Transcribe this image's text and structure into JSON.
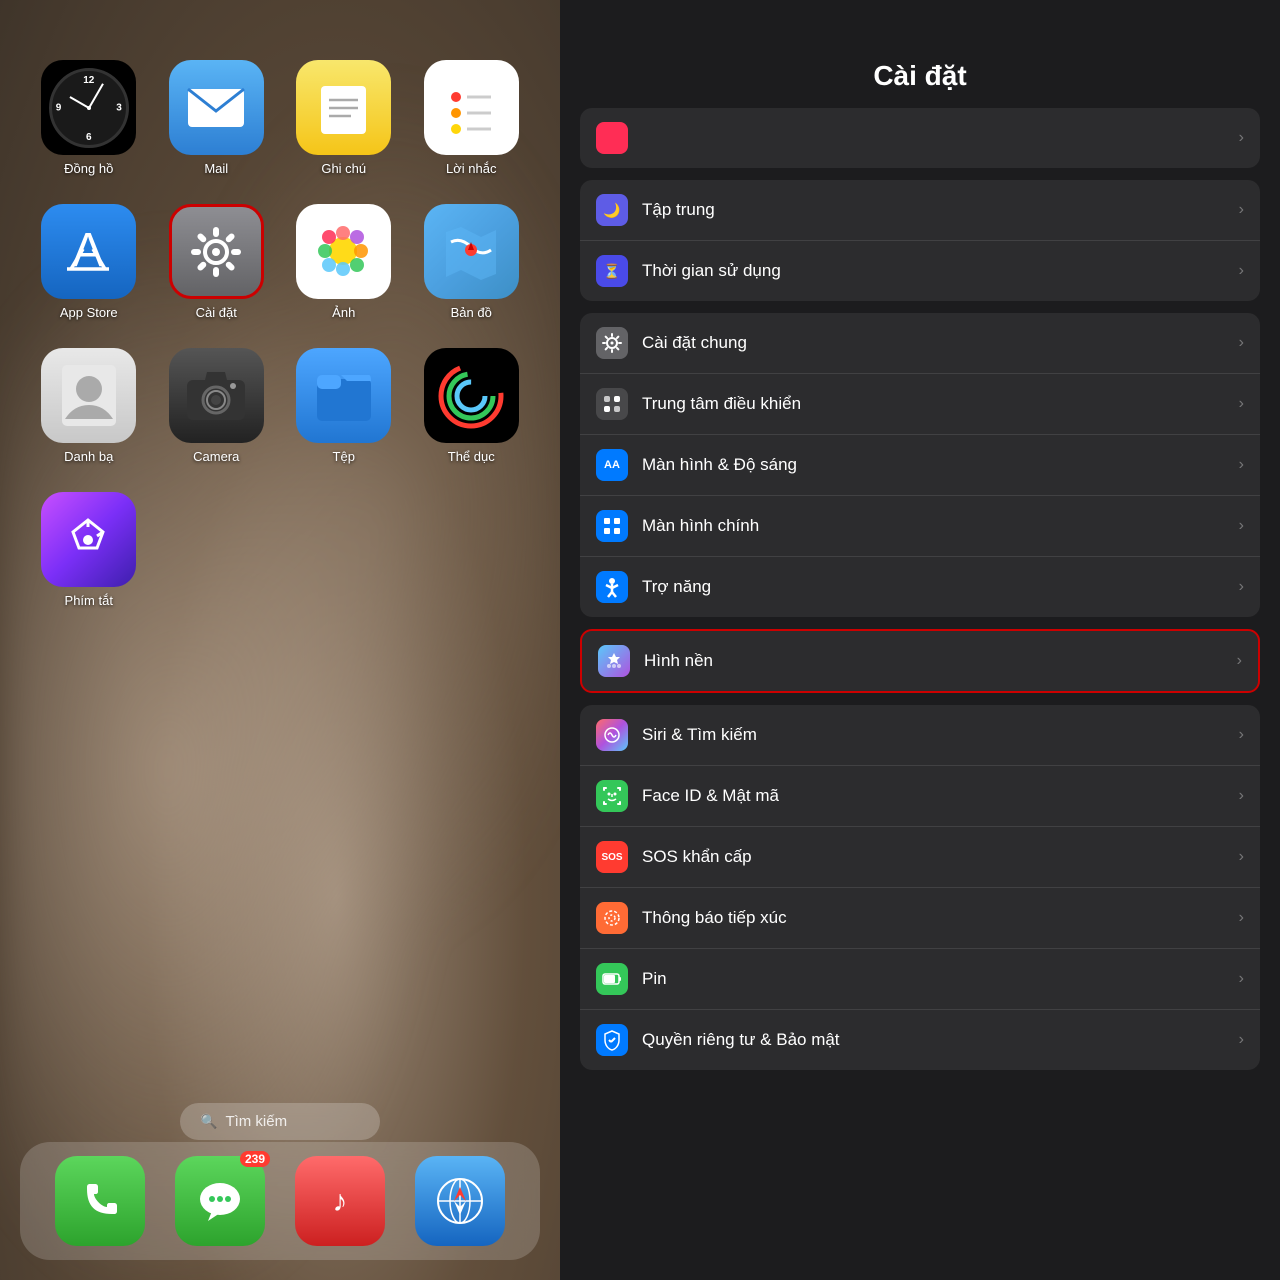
{
  "left": {
    "apps_row1": [
      {
        "id": "clock",
        "label": "Đồng hồ"
      },
      {
        "id": "mail",
        "label": "Mail"
      },
      {
        "id": "notes",
        "label": "Ghi chú"
      },
      {
        "id": "reminders",
        "label": "Lời nhắc"
      }
    ],
    "apps_row2": [
      {
        "id": "appstore",
        "label": "App Store"
      },
      {
        "id": "settings",
        "label": "Cài đặt"
      },
      {
        "id": "photos",
        "label": "Ảnh"
      },
      {
        "id": "maps",
        "label": "Bản đồ"
      }
    ],
    "apps_row3": [
      {
        "id": "contacts",
        "label": "Danh bạ"
      },
      {
        "id": "camera",
        "label": "Camera"
      },
      {
        "id": "files",
        "label": "Tệp"
      },
      {
        "id": "fitness",
        "label": "Thể dục"
      }
    ],
    "apps_row4": [
      {
        "id": "shortcuts",
        "label": "Phím tắt"
      }
    ],
    "search_placeholder": "Tìm kiếm",
    "dock": [
      {
        "id": "phone",
        "label": ""
      },
      {
        "id": "messages",
        "label": "",
        "badge": "239"
      },
      {
        "id": "music",
        "label": ""
      },
      {
        "id": "safari",
        "label": ""
      }
    ]
  },
  "right": {
    "title": "Cài đặt",
    "group_top_partial": [
      {
        "icon": "pink-circle",
        "label": "",
        "partial": true
      }
    ],
    "group1": [
      {
        "icon": "moon",
        "label": "Tập trung",
        "color": "ic-purple"
      },
      {
        "icon": "hourglass",
        "label": "Thời gian sử dụng",
        "color": "ic-indigo"
      }
    ],
    "group2": [
      {
        "icon": "gear",
        "label": "Cài đặt chung",
        "color": "ic-gray"
      },
      {
        "icon": "toggle",
        "label": "Trung tâm điều khiển",
        "color": "ic-dark-gray"
      },
      {
        "icon": "AA",
        "label": "Màn hình & Độ sáng",
        "color": "ic-aa-blue"
      },
      {
        "icon": "grid",
        "label": "Màn hình chính",
        "color": "ic-blue"
      },
      {
        "icon": "accessibility",
        "label": "Trợ năng",
        "color": "ic-blue"
      }
    ],
    "group3_highlighted": [
      {
        "icon": "snowflake",
        "label": "Hình nền",
        "color": "ic-wallpaper",
        "highlighted": true
      }
    ],
    "group4": [
      {
        "icon": "siri",
        "label": "Siri & Tìm kiếm",
        "color": "ic-siri"
      },
      {
        "icon": "faceid",
        "label": "Face ID & Mật mã",
        "color": "ic-faceid"
      },
      {
        "icon": "sos",
        "label": "SOS khẩn cấp",
        "color": "ic-sos"
      },
      {
        "icon": "exposure",
        "label": "Thông báo tiếp xúc",
        "color": "ic-exposure"
      },
      {
        "icon": "battery",
        "label": "Pin",
        "color": "ic-battery"
      },
      {
        "icon": "privacy",
        "label": "Quyền riêng tư & Bảo mật",
        "color": "ic-privacy"
      }
    ]
  }
}
